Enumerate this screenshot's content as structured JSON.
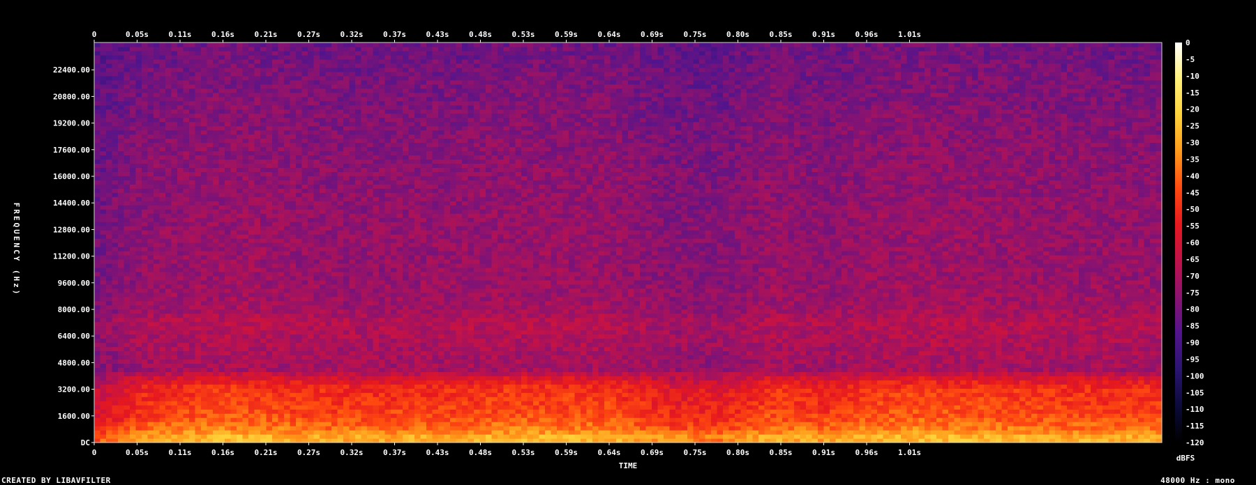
{
  "chart_data": {
    "type": "heatmap",
    "title": "",
    "xlabel": "TIME",
    "ylabel": "FREQUENCY (Hz)",
    "x_ticks": [
      "0",
      "0.05s",
      "0.11s",
      "0.16s",
      "0.21s",
      "0.27s",
      "0.32s",
      "0.37s",
      "0.43s",
      "0.48s",
      "0.53s",
      "0.59s",
      "0.64s",
      "0.69s",
      "0.75s",
      "0.80s",
      "0.85s",
      "0.91s",
      "0.96s",
      "1.01s"
    ],
    "x_range": [
      0,
      1.09
    ],
    "y_ticks": [
      "DC",
      "1600.00",
      "3200.00",
      "4800.00",
      "6400.00",
      "8000.00",
      "9600.00",
      "11200.00",
      "12800.00",
      "14400.00",
      "16000.00",
      "17600.00",
      "19200.00",
      "20800.00",
      "22400.00"
    ],
    "y_range": [
      0,
      24000
    ],
    "colorbar": {
      "label": "dBFS",
      "ticks": [
        "0",
        "-5",
        "-10",
        "-15",
        "-20",
        "-25",
        "-30",
        "-35",
        "-40",
        "-45",
        "-50",
        "-55",
        "-60",
        "-65",
        "-70",
        "-75",
        "-80",
        "-85",
        "-90",
        "-95",
        "-100",
        "-105",
        "-110",
        "-115",
        "-120"
      ],
      "range": [
        -120,
        0
      ],
      "colormap": [
        "#000000",
        "#0b0a3a",
        "#2a1470",
        "#52148c",
        "#8a1370",
        "#c0124a",
        "#e6181f",
        "#ff4a10",
        "#ff9a1a",
        "#ffd23a",
        "#fff07a",
        "#ffffff"
      ]
    },
    "spectrum_profile": {
      "freq_hz": [
        0,
        300,
        800,
        1600,
        2400,
        3200,
        3800,
        4400,
        6000,
        7200,
        8000,
        10000,
        14000,
        18000,
        22000,
        24000
      ],
      "level_dbfs": [
        -30,
        -28,
        -38,
        -45,
        -48,
        -50,
        -58,
        -72,
        -70,
        -68,
        -72,
        -74,
        -75,
        -77,
        -80,
        -82
      ]
    },
    "loudness_over_time": {
      "time_s": [
        0,
        0.05,
        0.11,
        0.16,
        0.21,
        0.27,
        0.32,
        0.37,
        0.43,
        0.48,
        0.53,
        0.59,
        0.64,
        0.69,
        0.75,
        0.8,
        0.85,
        0.91,
        0.96,
        1.01,
        1.09
      ],
      "offset_db": [
        -14,
        -2,
        2,
        3,
        0,
        -1,
        0,
        0,
        2,
        2,
        1,
        -6,
        -7,
        1,
        -2,
        2,
        3,
        2,
        1,
        0,
        0
      ]
    }
  },
  "footer": {
    "left": "CREATED BY LIBAVFILTER",
    "right": "48000 Hz : mono"
  },
  "colors": {
    "background": "#000000",
    "axis": "#ffffff",
    "frame": "#cfcfcf"
  }
}
